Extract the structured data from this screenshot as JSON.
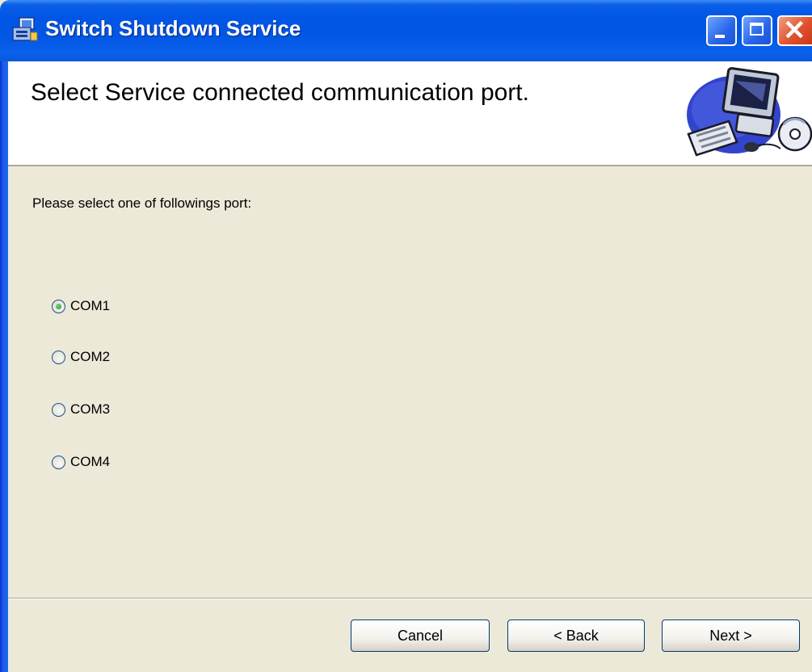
{
  "window": {
    "title": "Switch Shutdown Service",
    "app_icon": "installer-icon",
    "controls": [
      "minimize-icon",
      "maximize-icon",
      "close-icon"
    ]
  },
  "banner": {
    "title": "Select Service connected communication port.",
    "graphic": "computer-icon"
  },
  "body": {
    "prompt": "Please select one of followings port:",
    "ports": [
      {
        "label": "COM1",
        "selected": true
      },
      {
        "label": "COM2",
        "selected": false
      },
      {
        "label": "COM3",
        "selected": false
      },
      {
        "label": "COM4",
        "selected": false
      }
    ]
  },
  "footer": {
    "cancel_label": "Cancel",
    "back_label": "< Back",
    "next_label": "Next >"
  },
  "colors": {
    "titlebar": "#0055E5",
    "dialog_bg": "#ECE9D8",
    "selected_radio": "#21A121"
  }
}
